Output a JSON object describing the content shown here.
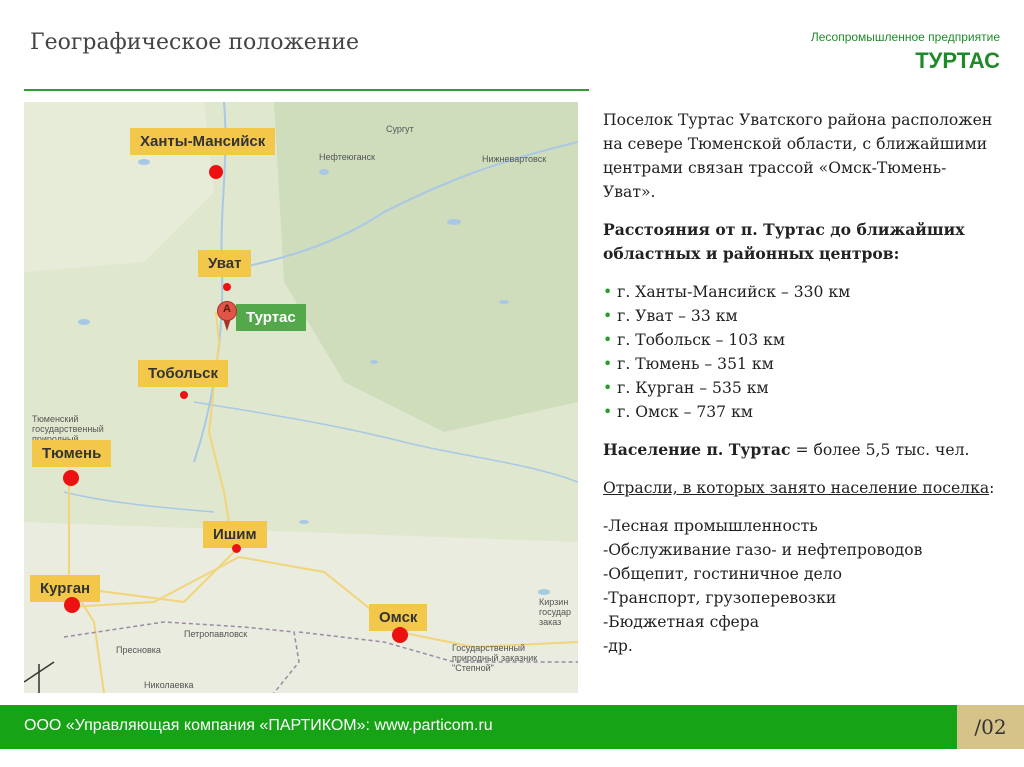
{
  "header": {
    "title": "Географическое положение",
    "company_subtitle": "Лесопромышленное предприятие",
    "company_name": "ТУРТАС"
  },
  "map": {
    "city_labels": [
      {
        "id": "khanty",
        "name": "Ханты-Мансийск"
      },
      {
        "id": "uvat",
        "name": "Уват"
      },
      {
        "id": "turtas",
        "name": "Туртас"
      },
      {
        "id": "tobolsk",
        "name": "Тобольск"
      },
      {
        "id": "tyumen",
        "name": "Тюмень"
      },
      {
        "id": "ishim",
        "name": "Ишим"
      },
      {
        "id": "kurgan",
        "name": "Курган"
      },
      {
        "id": "omsk",
        "name": "Омск"
      }
    ],
    "pin_letter": "A",
    "small_labels": {
      "surgut": "Сургут",
      "nefteyugansk": "Нефтеюганск",
      "nizhnevartovsk": "Нижневартовск",
      "tyumen_reserve": "Тюменский государственный природный заказник",
      "petropavlovsk": "Петропавловск",
      "presnovka": "Пресновка",
      "nikolaevka": "Николаевка",
      "kirzin": "Кирзин государ заказ",
      "stepnoy": "Государственный природный заказник \"Степной\""
    },
    "colors": {
      "label_bg": "#f3c84a",
      "turtas_label_bg": "#53a84b",
      "dot": "#ee1111"
    }
  },
  "content": {
    "intro": "Поселок Туртас Уватского района расположен на севере Тюменской области, с ближайшими центрами связан трассой «Омск-Тюмень-Уват».",
    "distances_heading": "Расстояния от п. Туртас до ближайших областных и районных центров:",
    "distances": [
      "г. Ханты-Мансийск – 330 км",
      "г. Уват – 33 км",
      "г. Тобольск – 103 км",
      "г. Тюмень – 351 км",
      "г.  Курган – 535 км",
      "г. Омск – 737 км"
    ],
    "population_label": "Население п. Туртас",
    "population_value": " = более 5,5 тыс. чел.",
    "industries_heading": "Отрасли, в которых занято население поселка",
    "industries_colon": ":",
    "industries": [
      "-Лесная промышленность",
      "-Обслуживание газо- и нефтепроводов",
      "-Общепит,  гостиничное дело",
      "-Транспорт, грузоперевозки",
      "-Бюджетная сфера",
      "-др."
    ]
  },
  "footer": {
    "text": "ООО «Управляющая компания «ПАРТИКОМ»: www.particom.ru",
    "page": "/02"
  }
}
